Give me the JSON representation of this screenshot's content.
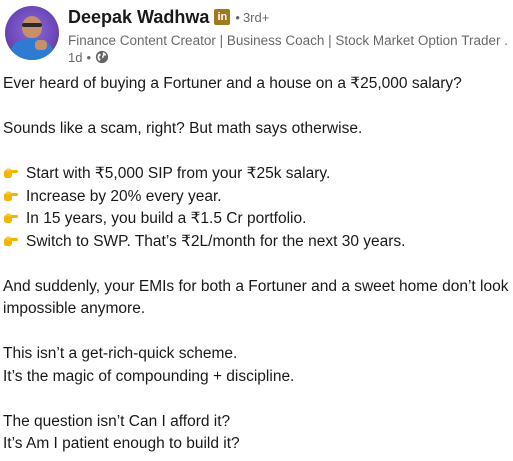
{
  "author": {
    "name": "Deepak Wadhwa",
    "badge": "in",
    "separator": "•",
    "degree": "3rd+",
    "headline": "Finance Content Creator | Business Coach | Stock Market Option Trader ...",
    "time": "1d",
    "time_separator": "•",
    "visibility_icon": "globe-icon",
    "badge_color": "#a07a1f"
  },
  "post": {
    "p1": "Ever heard of buying a Fortuner and a house on a ₹25,000 salary?",
    "p2": "Sounds like a scam, right? But math says otherwise.",
    "points": [
      "Start with ₹5,000 SIP from your ₹25k salary.",
      "Increase by 20% every year.",
      "In 15 years, you build a ₹1.5 Cr portfolio.",
      "Switch to SWP. That’s ₹2L/month for the next 30 years."
    ],
    "point_icon": "pointing-hand-icon",
    "p3_line1": "And suddenly, your EMIs for both a Fortuner and a sweet home don’t look",
    "p3_line2": "impossible anymore.",
    "p4_line1": "This isn’t a get-rich-quick scheme.",
    "p4_line2": "It’s the magic of compounding + discipline.",
    "p5_line1": "The question isn’t Can I afford it?",
    "p5_line2": "It’s Am I patient enough to build it?"
  }
}
